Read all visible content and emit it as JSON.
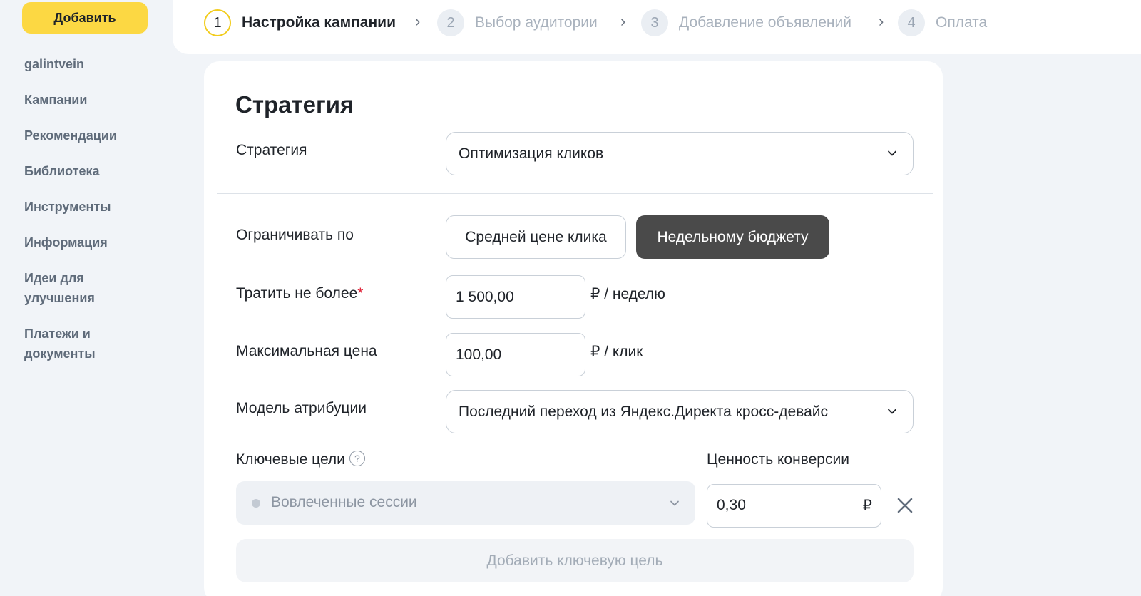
{
  "sidebar": {
    "add_button": "Добавить",
    "items": [
      {
        "label": "galintvein"
      },
      {
        "label": "Кампании"
      },
      {
        "label": "Рекомендации"
      },
      {
        "label": "Библиотека"
      },
      {
        "label": "Инструменты"
      },
      {
        "label": "Информация"
      },
      {
        "label": "Идеи для\nулучшения"
      },
      {
        "label": "Платежи и\nдокументы"
      }
    ]
  },
  "stepper": {
    "steps": [
      {
        "num": "1",
        "label": "Настройка кампании",
        "active": true
      },
      {
        "num": "2",
        "label": "Выбор аудитории",
        "active": false
      },
      {
        "num": "3",
        "label": "Добавление объявлений",
        "active": false
      },
      {
        "num": "4",
        "label": "Оплата",
        "active": false
      }
    ],
    "separator": "›"
  },
  "strategy": {
    "title": "Стратегия",
    "strategy_label": "Стратегия",
    "strategy_value": "Оптимизация кликов",
    "limit_label": "Ограничивать по",
    "limit_options": [
      "Средней цене клика",
      "Недельному бюджету"
    ],
    "limit_selected": "Недельному бюджету",
    "spend_label": "Тратить не более",
    "spend_required": "*",
    "spend_value": "1 500,00",
    "spend_unit": "₽ / неделю",
    "max_price_label": "Максимальная цена",
    "max_price_value": "100,00",
    "max_price_unit": "₽ / клик",
    "attribution_label": "Модель атрибуции",
    "attribution_value": "Последний переход из Яндекс.Директа кросс-девайс",
    "key_goals_label": "Ключевые цели",
    "conversion_value_label": "Ценность конверсии",
    "goal_value": "Вовлеченные сессии",
    "conversion_value": "0,30",
    "conversion_unit": "₽",
    "add_goal_button": "Добавить ключевую цель"
  }
}
